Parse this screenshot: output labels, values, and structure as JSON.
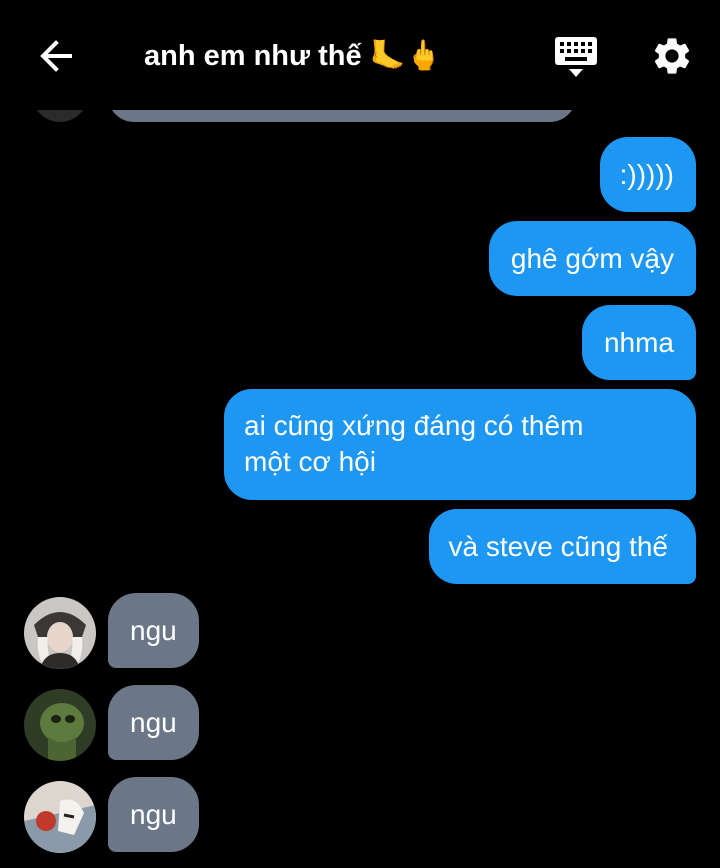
{
  "header": {
    "title": "anh em như thế 🦶🖕",
    "back_icon": "arrow-left-icon",
    "keyboard_icon": "keyboard-icon",
    "settings_icon": "gear-icon"
  },
  "colors": {
    "background": "#000000",
    "outgoing_bubble": "#1d97f2",
    "incoming_bubble": "#6b7787",
    "text": "#ffffff"
  },
  "messages": [
    {
      "direction": "out",
      "text": ":)))))"
    },
    {
      "direction": "out",
      "text": "ghê gớm vậy"
    },
    {
      "direction": "out",
      "text": "nhma"
    },
    {
      "direction": "out",
      "text": "ai cũng xứng đáng có thêm một cơ hội"
    },
    {
      "direction": "out",
      "text": "và steve cũng thế"
    },
    {
      "direction": "in",
      "text": "ngu"
    },
    {
      "direction": "in",
      "text": "ngu"
    },
    {
      "direction": "in",
      "text": "ngu"
    }
  ]
}
